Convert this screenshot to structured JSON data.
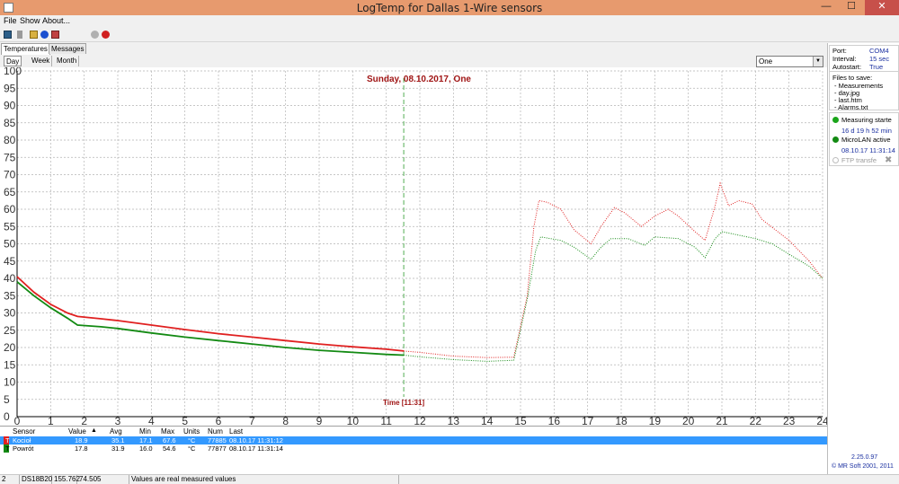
{
  "window": {
    "title": "LogTemp for Dallas 1-Wire sensors",
    "min": "—",
    "max": "☐",
    "close": "✕"
  },
  "menu": [
    "File",
    "Show",
    "About..."
  ],
  "toolbar_icons": [
    "save-icon",
    "delete-icon",
    "open-folder-icon",
    "info-icon",
    "alarm-icon",
    "network-disabled-icon",
    "stop-icon"
  ],
  "tabs": [
    {
      "label": "Temperatures",
      "active": true
    },
    {
      "label": "Messages",
      "active": false
    }
  ],
  "subtabs": [
    {
      "label": "Day",
      "active": true
    },
    {
      "label": "Week",
      "active": false
    },
    {
      "label": "Month",
      "active": false
    }
  ],
  "sensor_select": {
    "value": "One"
  },
  "right_panel": {
    "port_label": "Port:",
    "port_value": "COM4",
    "interval_label": "Interval:",
    "interval_value": "15 sec",
    "autostart_label": "Autostart:",
    "autostart_value": "True",
    "files_title": "Files to save:",
    "files": [
      "- Measurements",
      "- day.jpg",
      "- last.htm",
      "- Alarms.txt"
    ],
    "measuring": "Measuring starte",
    "measuring_time": "16 d 19 h 52 min",
    "microlan": "MicroLAN active",
    "microlan_time": "08.10.17 11:31:14",
    "ftp": "FTP transfe",
    "version": "2.25.0.97",
    "copyright": "© MR Soft 2001, 2011",
    "colors": {
      "active": "#1aa51a",
      "inactive": "#bdbdbd"
    }
  },
  "table": {
    "headers": [
      "Sensor",
      "Value",
      "Avg",
      "Min",
      "Max",
      "Units",
      "Num",
      "Last"
    ],
    "rows": [
      {
        "code": "T",
        "name": "Kocioł",
        "value": "18.9",
        "avg": "35.1",
        "min": "17.1",
        "max": "67.6",
        "units": "°C",
        "num": "77885",
        "last": "08.10.17 11:31:12",
        "color": "#e02020",
        "selected": true
      },
      {
        "code": "T",
        "name": "Powrót",
        "value": "17.8",
        "avg": "31.9",
        "min": "16.0",
        "max": "54.6",
        "units": "°C",
        "num": "77877",
        "last": "08.10.17 11:31:14",
        "color": "#138a13",
        "selected": false
      }
    ]
  },
  "status": [
    "2",
    "DS18B20",
    "155.762",
    "74.505",
    "Values are real measured values"
  ],
  "chart_data": {
    "type": "line",
    "title": "Sunday, 08.10.2017, One",
    "time_marker": {
      "x": 11.52,
      "label": "Time [11:31]"
    },
    "xlim": [
      0,
      24
    ],
    "ylim": [
      0,
      100
    ],
    "x_ticks": [
      0,
      1,
      2,
      3,
      4,
      5,
      6,
      7,
      8,
      9,
      10,
      11,
      12,
      13,
      14,
      15,
      16,
      17,
      18,
      19,
      20,
      21,
      22,
      23,
      24
    ],
    "y_ticks": [
      0,
      5,
      10,
      15,
      20,
      25,
      30,
      35,
      40,
      45,
      50,
      55,
      60,
      65,
      70,
      75,
      80,
      85,
      90,
      95,
      100
    ],
    "grid": true,
    "series": [
      {
        "name": "Kocioł",
        "color": "#e02020",
        "measured": [
          [
            0,
            40.5
          ],
          [
            0.5,
            36
          ],
          [
            1,
            32.5
          ],
          [
            1.5,
            30
          ],
          [
            1.8,
            29
          ],
          [
            2.5,
            28.3
          ],
          [
            3,
            27.8
          ],
          [
            4,
            26.5
          ],
          [
            5,
            25.2
          ],
          [
            6,
            24
          ],
          [
            7,
            23
          ],
          [
            8,
            22
          ],
          [
            9,
            21
          ],
          [
            10,
            20.2
          ],
          [
            11,
            19.5
          ],
          [
            11.52,
            19
          ]
        ],
        "previous": [
          [
            11.52,
            19
          ],
          [
            12,
            18.6
          ],
          [
            13,
            17.5
          ],
          [
            14,
            17.1
          ],
          [
            14.8,
            17.2
          ],
          [
            15.2,
            35
          ],
          [
            15.4,
            55
          ],
          [
            15.55,
            62.5
          ],
          [
            15.8,
            62
          ],
          [
            16.2,
            60
          ],
          [
            16.6,
            54
          ],
          [
            17.1,
            50
          ],
          [
            17.4,
            55
          ],
          [
            17.8,
            60.5
          ],
          [
            18.1,
            59
          ],
          [
            18.6,
            55
          ],
          [
            19,
            58
          ],
          [
            19.4,
            60
          ],
          [
            19.7,
            58
          ],
          [
            20.2,
            53.5
          ],
          [
            20.5,
            51
          ],
          [
            20.8,
            61
          ],
          [
            20.95,
            67.5
          ],
          [
            21.2,
            61
          ],
          [
            21.5,
            62.5
          ],
          [
            21.9,
            61.5
          ],
          [
            22.2,
            57
          ],
          [
            23,
            51
          ],
          [
            23.6,
            45
          ],
          [
            24,
            40
          ]
        ]
      },
      {
        "name": "Powrót",
        "color": "#138a13",
        "measured": [
          [
            0,
            39
          ],
          [
            0.5,
            35
          ],
          [
            1,
            31.5
          ],
          [
            1.5,
            28.5
          ],
          [
            1.8,
            26.5
          ],
          [
            2.5,
            26
          ],
          [
            3,
            25.5
          ],
          [
            4,
            24.2
          ],
          [
            5,
            23
          ],
          [
            6,
            22
          ],
          [
            7,
            21
          ],
          [
            8,
            20
          ],
          [
            9,
            19.2
          ],
          [
            10,
            18.6
          ],
          [
            11,
            18
          ],
          [
            11.52,
            17.8
          ]
        ],
        "previous": [
          [
            11.52,
            17.8
          ],
          [
            12,
            17.3
          ],
          [
            13,
            16.5
          ],
          [
            14,
            16
          ],
          [
            14.8,
            16.3
          ],
          [
            15.2,
            34
          ],
          [
            15.45,
            48
          ],
          [
            15.6,
            52
          ],
          [
            16.2,
            51
          ],
          [
            16.6,
            49
          ],
          [
            17.1,
            45.5
          ],
          [
            17.4,
            49
          ],
          [
            17.7,
            51.5
          ],
          [
            18.2,
            51.5
          ],
          [
            18.7,
            49.5
          ],
          [
            19,
            52
          ],
          [
            19.7,
            51.5
          ],
          [
            20.2,
            49
          ],
          [
            20.5,
            46
          ],
          [
            20.8,
            51.5
          ],
          [
            21,
            53.5
          ],
          [
            21.5,
            52.5
          ],
          [
            22,
            51.5
          ],
          [
            22.5,
            50
          ],
          [
            23,
            47
          ],
          [
            23.6,
            43.5
          ],
          [
            24,
            40
          ]
        ]
      }
    ]
  }
}
